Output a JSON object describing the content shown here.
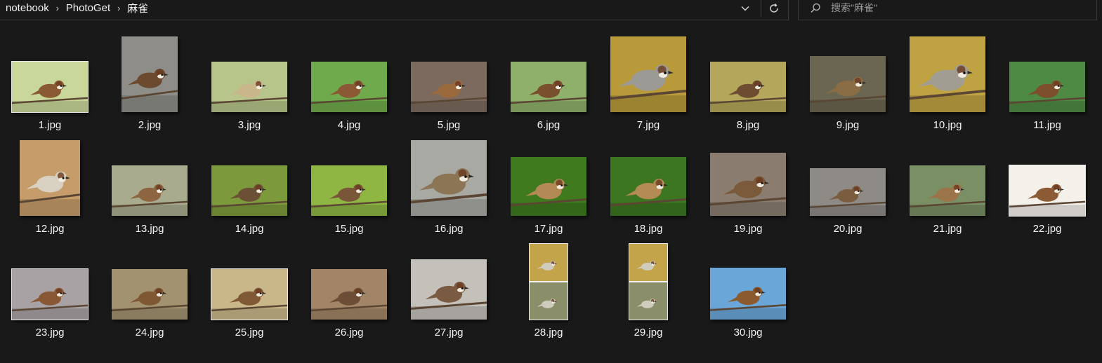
{
  "breadcrumb": {
    "items": [
      "notebook",
      "PhotoGet",
      "麻雀"
    ],
    "separator": "›"
  },
  "search": {
    "placeholder": "搜索\"麻雀\""
  },
  "files": [
    {
      "name": "1.jpg",
      "bg": "#c9d79a",
      "bird": "#8a5a33"
    },
    {
      "name": "2.jpg",
      "bg": "#8e8d88",
      "bird": "#6b4a2f"
    },
    {
      "name": "3.jpg",
      "bg": "#b7c48a",
      "bird": "#c9b68a"
    },
    {
      "name": "4.jpg",
      "bg": "#6faa4c",
      "bird": "#8b5a34"
    },
    {
      "name": "5.jpg",
      "bg": "#7b6a5d",
      "bird": "#9a6a3d"
    },
    {
      "name": "6.jpg",
      "bg": "#8fb06a",
      "bird": "#7a4f2e"
    },
    {
      "name": "7.jpg",
      "bg": "#b89a3a",
      "bird": "#9c9a94"
    },
    {
      "name": "8.jpg",
      "bg": "#b4a65a",
      "bird": "#6e4c31"
    },
    {
      "name": "9.jpg",
      "bg": "#6b6651",
      "bird": "#8a6d45"
    },
    {
      "name": "10.jpg",
      "bg": "#bfa343",
      "bird": "#a19d93"
    },
    {
      "name": "11.jpg",
      "bg": "#4f8a45",
      "bird": "#7d4f2c"
    },
    {
      "name": "12.jpg",
      "bg": "#c59c6a",
      "bird": "#d9d1c2"
    },
    {
      "name": "13.jpg",
      "bg": "#a8ab8e",
      "bird": "#8d6540"
    },
    {
      "name": "14.jpg",
      "bg": "#7c9a3c",
      "bird": "#6b5036"
    },
    {
      "name": "15.jpg",
      "bg": "#8fb643",
      "bird": "#7a5638"
    },
    {
      "name": "16.jpg",
      "bg": "#a9a9a4",
      "bird": "#8c7555"
    },
    {
      "name": "17.jpg",
      "bg": "#3f7a1f",
      "bird": "#b38a55"
    },
    {
      "name": "18.jpg",
      "bg": "#3d7620",
      "bird": "#b48a55"
    },
    {
      "name": "19.jpg",
      "bg": "#8a7d70",
      "bird": "#7b5a3b"
    },
    {
      "name": "20.jpg",
      "bg": "#8e8a86",
      "bird": "#7a5c3f"
    },
    {
      "name": "21.jpg",
      "bg": "#7a8f63",
      "bird": "#9c744a"
    },
    {
      "name": "22.jpg",
      "bg": "#f4f0ea",
      "bird": "#8c5a34"
    },
    {
      "name": "23.jpg",
      "bg": "#a9a2a5",
      "bird": "#8a5734"
    },
    {
      "name": "24.jpg",
      "bg": "#a39270",
      "bird": "#7e5733"
    },
    {
      "name": "25.jpg",
      "bg": "#c9b789",
      "bird": "#7f5835"
    },
    {
      "name": "26.jpg",
      "bg": "#a28566",
      "bird": "#6b4e35"
    },
    {
      "name": "27.jpg",
      "bg": "#c4c0ba",
      "bird": "#7a5b42"
    },
    {
      "name": "28.jpg",
      "bg": "#6b6a52",
      "bird": "#cfcbbd"
    },
    {
      "name": "29.jpg",
      "bg": "#6b6a52",
      "bird": "#cfcbbd"
    },
    {
      "name": "30.jpg",
      "bg": "#6aa6d8",
      "bird": "#8b5a2e"
    }
  ]
}
